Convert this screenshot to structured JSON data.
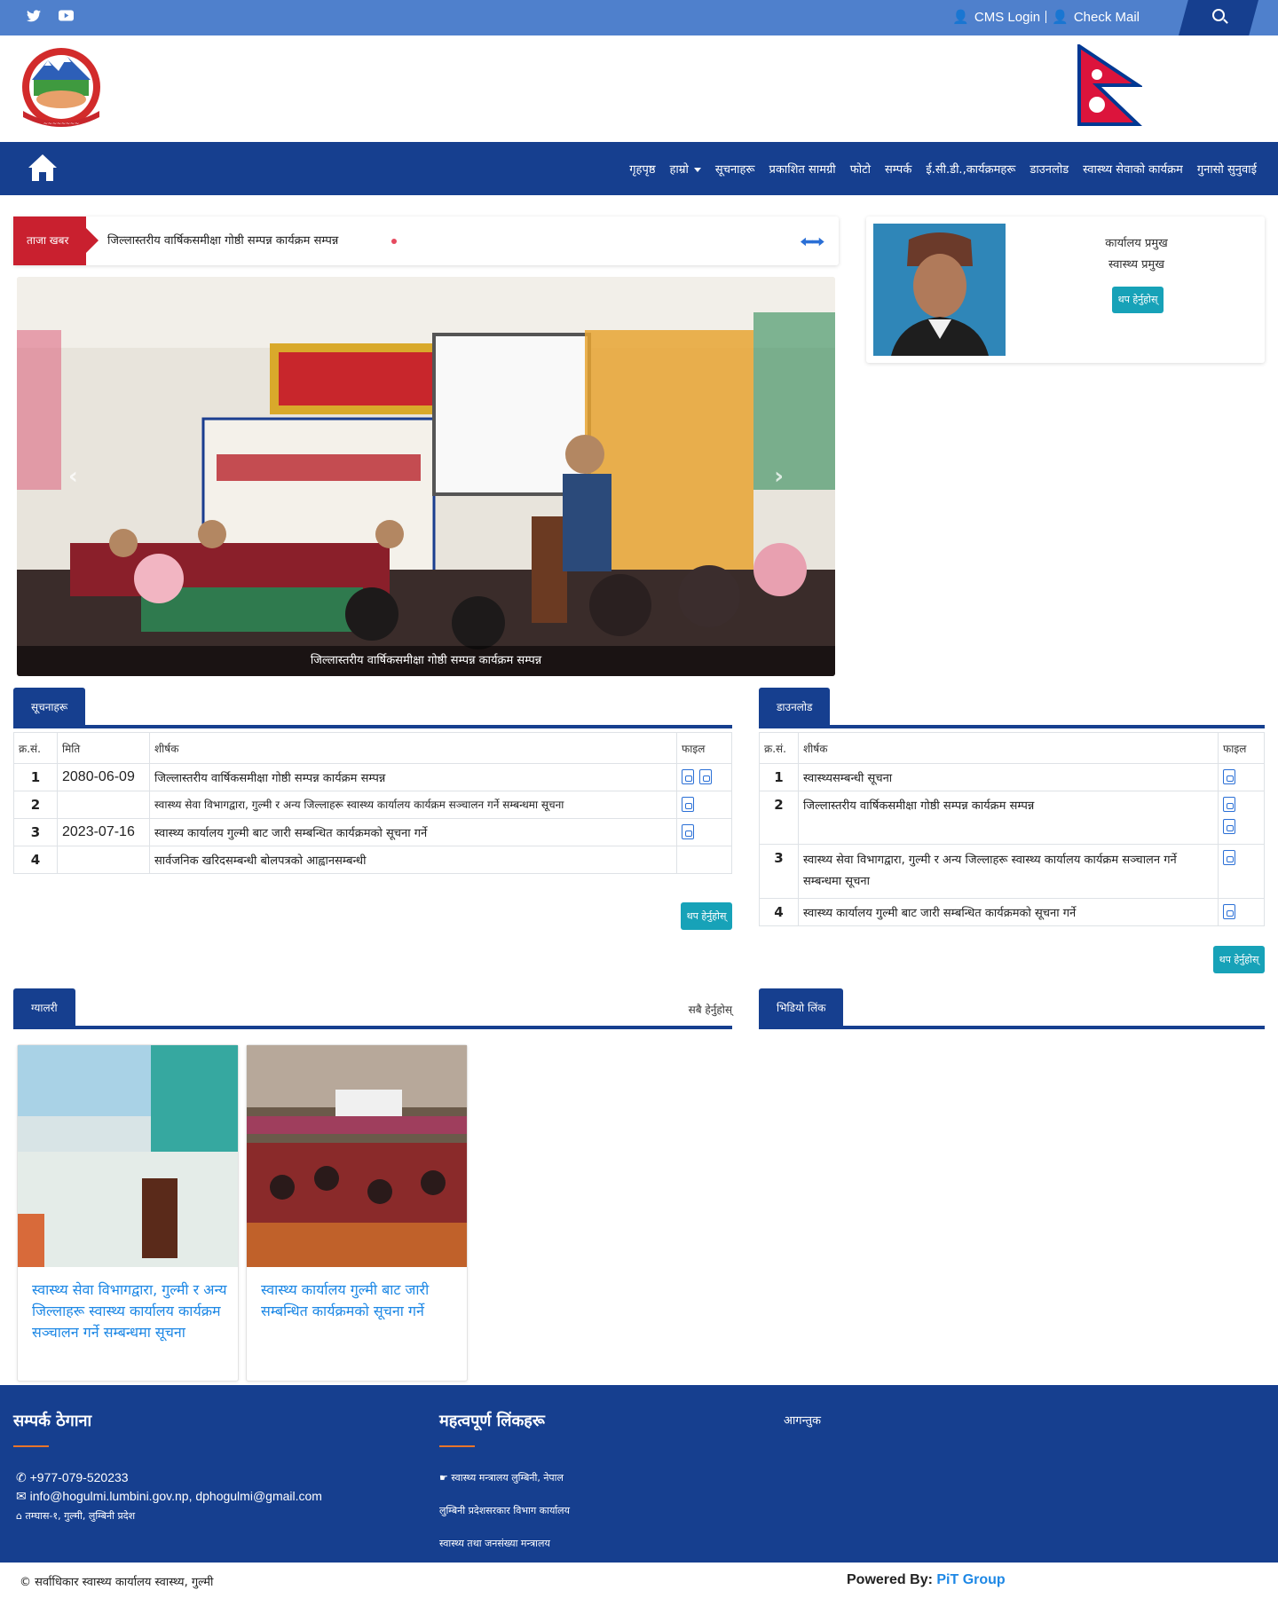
{
  "topbar": {
    "social": [
      "twitter-icon",
      "youtube-icon"
    ],
    "cms_login": "CMS Login",
    "check_mail": "Check Mail"
  },
  "nav": {
    "items": [
      "गृहपृष्ठ",
      "हाम्रो",
      "सूचनाहरू",
      "प्रकाशित सामग्री",
      "फोटो",
      "सम्पर्क",
      "ई.सी.डी.,कार्यक्रमहरू",
      "डाउनलोड",
      "स्वास्थ्य सेवाको कार्यक्रम",
      "गुनासो सुनुवाई"
    ]
  },
  "ticker": {
    "label": "ताजा खबर",
    "text": "जिल्लास्तरीय वार्षिकसमीक्षा गोष्ठी सम्पन्न कार्यक्रम सम्पन्न"
  },
  "slider": {
    "caption": "जिल्लास्तरीय वार्षिकसमीक्षा गोष्ठी सम्पन्न कार्यक्रम सम्पन्न"
  },
  "profile": {
    "name": "कार्यालय प्रमुख",
    "role": "स्वास्थ्य प्रमुख",
    "button": "थप हेर्नुहोस्"
  },
  "notices": {
    "title": "सूचनाहरू",
    "headers": [
      "क्र.सं.",
      "मिति",
      "शीर्षक",
      "फाइल"
    ],
    "rows": [
      {
        "n": "1",
        "date": "2080-06-09",
        "title": "जिल्लास्तरीय वार्षिकसमीक्षा गोष्ठी सम्पन्न कार्यक्रम सम्पन्न",
        "files": 2
      },
      {
        "n": "2",
        "date": "",
        "title": "स्वास्थ्य सेवा विभागद्वारा, गुल्मी र अन्य जिल्लाहरू स्वास्थ्य कार्यालय कार्यक्रम सञ्चालन गर्ने सम्बन्धमा सूचना",
        "files": 1
      },
      {
        "n": "3",
        "date": "2023-07-16",
        "title": "स्वास्थ्य कार्यालय गुल्मी बाट जारी सम्बन्धित कार्यक्रमको सूचना गर्ने",
        "files": 1
      },
      {
        "n": "4",
        "date": "",
        "title": "सार्वजनिक खरिदसम्बन्धी बोलपत्रको आह्वानसम्बन्धी",
        "files": 0
      }
    ],
    "more": "थप हेर्नुहोस्"
  },
  "downloads": {
    "title": "डाउनलोड",
    "headers": [
      "क्र.सं.",
      "शीर्षक",
      "फाइल"
    ],
    "rows": [
      {
        "n": "1",
        "title": "स्वास्थ्यसम्बन्धी सूचना",
        "files": 1
      },
      {
        "n": "2",
        "title": "जिल्लास्तरीय वार्षिकसमीक्षा गोष्ठी सम्पन्न कार्यक्रम सम्पन्न",
        "files": 2
      },
      {
        "n": "3",
        "title": "स्वास्थ्य सेवा विभागद्वारा, गुल्मी र अन्य जिल्लाहरू स्वास्थ्य कार्यालय कार्यक्रम सञ्चालन गर्ने सम्बन्धमा सूचना",
        "files": 1
      },
      {
        "n": "4",
        "title": "स्वास्थ्य कार्यालय गुल्मी बाट जारी सम्बन्धित कार्यक्रमको सूचना गर्ने",
        "files": 1
      }
    ],
    "more": "थप हेर्नुहोस्"
  },
  "gallery": {
    "title": "ग्यालरी",
    "more": "सबै हेर्नुहोस्",
    "cards": [
      {
        "title": "स्वास्थ्य सेवा विभागद्वारा, गुल्मी र अन्य जिल्लाहरू स्वास्थ्य कार्यालय कार्यक्रम सञ्चालन गर्ने सम्बन्धमा सूचना"
      },
      {
        "title": "स्वास्थ्य कार्यालय गुल्मी बाट जारी सम्बन्धित कार्यक्रमको सूचना गर्ने"
      }
    ]
  },
  "video": {
    "title": "भिडियो लिंक"
  },
  "footer": {
    "contact_title": "सम्पर्क ठेगाना",
    "phone": "+977-079-520233",
    "email": "info@hogulmi.lumbini.gov.np, dphogulmi@gmail.com",
    "address": "तम्घास-१, गुल्मी, लुम्बिनी प्रदेश",
    "links_title": "महत्वपूर्ण लिंकहरू",
    "links": [
      "स्वास्थ्य मन्त्रालय लुम्बिनी, नेपाल",
      "लुम्बिनी प्रदेशसरकार विभाग कार्यालय",
      "स्वास्थ्य तथा जनसंख्या मन्त्रालय"
    ],
    "visitors_title": "आगन्तुक",
    "copyright": "© सर्वाधिकार स्वास्थ्य कार्यालय स्वास्थ्य, गुल्मी",
    "powered_label": "Powered By:",
    "powered_by": "PiT Group"
  }
}
